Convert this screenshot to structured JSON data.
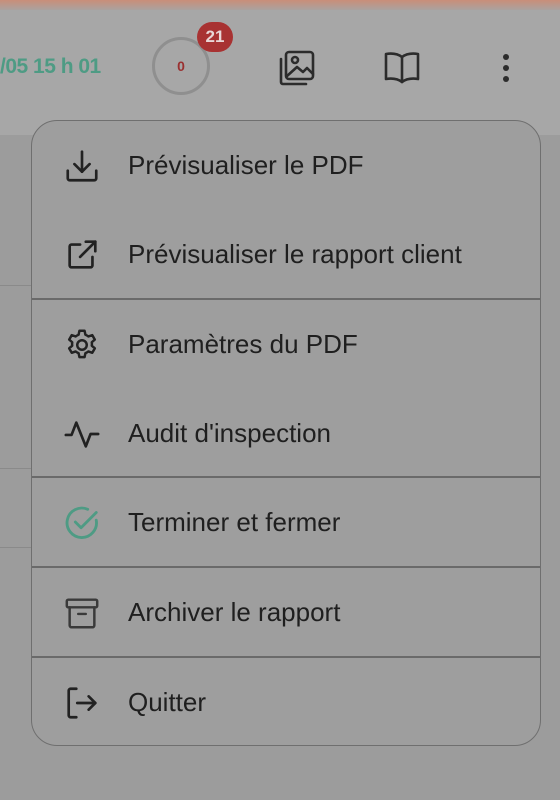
{
  "header": {
    "timestamp": "/05 15 h 01",
    "progress_value": "0",
    "notification_count": "21",
    "icons": [
      "image-gallery-icon",
      "open-book-icon",
      "more-vertical-icon"
    ]
  },
  "menu": {
    "items": [
      {
        "label": "Prévisualiser le PDF",
        "icon": "download-icon"
      },
      {
        "label": "Prévisualiser le rapport client",
        "icon": "external-link-icon"
      },
      {
        "label": "Paramètres du PDF",
        "icon": "gear-icon"
      },
      {
        "label": "Audit d'inspection",
        "icon": "activity-icon"
      },
      {
        "label": "Terminer et fermer",
        "icon": "check-circle-icon"
      },
      {
        "label": "Archiver le rapport",
        "icon": "archive-icon"
      },
      {
        "label": "Quitter",
        "icon": "logout-icon"
      }
    ]
  },
  "colors": {
    "accent_green": "#4e9b84",
    "badge_red": "#a83232",
    "overlay_gray": "#9b9b9b"
  }
}
